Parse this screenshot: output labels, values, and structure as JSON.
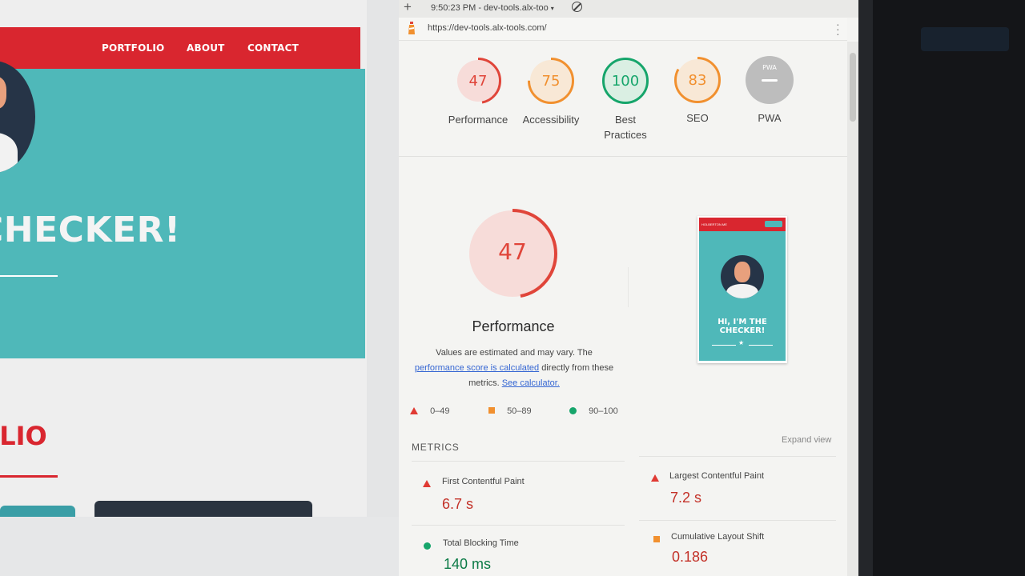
{
  "site": {
    "nav": [
      "PORTFOLIO",
      "ABOUT",
      "CONTACT"
    ],
    "hero_title": "CHECKER!",
    "section_title": "OLIO"
  },
  "tab": {
    "plus": "+",
    "title": "9:50:23 PM - dev-tools.alx-too",
    "caret": "▾"
  },
  "url": "https://dev-tools.alx-tools.com/",
  "scores": [
    {
      "label": "Performance",
      "value": "47",
      "score": 47,
      "color": "#e0453a",
      "bg": "#f7dcd9"
    },
    {
      "label": "Accessibility",
      "value": "75",
      "score": 75,
      "color": "#f1902f",
      "bg": "#f8e8d6"
    },
    {
      "label": "Best Practices",
      "value": "100",
      "score": 100,
      "color": "#16a56b",
      "bg": "#daefe3"
    },
    {
      "label": "SEO",
      "value": "83",
      "score": 83,
      "color": "#f1902f",
      "bg": "#f8e8d6"
    },
    {
      "label": "PWA",
      "value": "PWA",
      "color": "#bdbdbd"
    }
  ],
  "performance": {
    "score": "47",
    "title": "Performance",
    "desc_1": "Values are estimated and may vary. The",
    "desc_link": "performance score is calculated",
    "desc_2": "directly from these",
    "desc_3": "metrics.",
    "calc_link": "See calculator."
  },
  "legend": [
    "0–49",
    "50–89",
    "90–100"
  ],
  "thumbnail": {
    "nav_text": "HOLBERTON.ME",
    "title_1": "HI, I'M THE",
    "title_2": "CHECKER!",
    "star": "★"
  },
  "metrics": {
    "heading": "METRICS",
    "expand": "Expand view",
    "items": [
      {
        "title": "First Contentful Paint",
        "value": "6.7 s",
        "status": "fail"
      },
      {
        "title": "Largest Contentful Paint",
        "value": "7.2 s",
        "status": "fail"
      },
      {
        "title": "Total Blocking Time",
        "value": "140 ms",
        "status": "pass"
      },
      {
        "title": "Cumulative Layout Shift",
        "value": "0.186",
        "status": "average"
      }
    ]
  },
  "colors": {
    "fail": "#e0453a",
    "average": "#f1902f",
    "pass": "#16a56b",
    "pass_value": "#0b7a46",
    "fail_value": "#c33128",
    "average_value": "#c33128"
  }
}
